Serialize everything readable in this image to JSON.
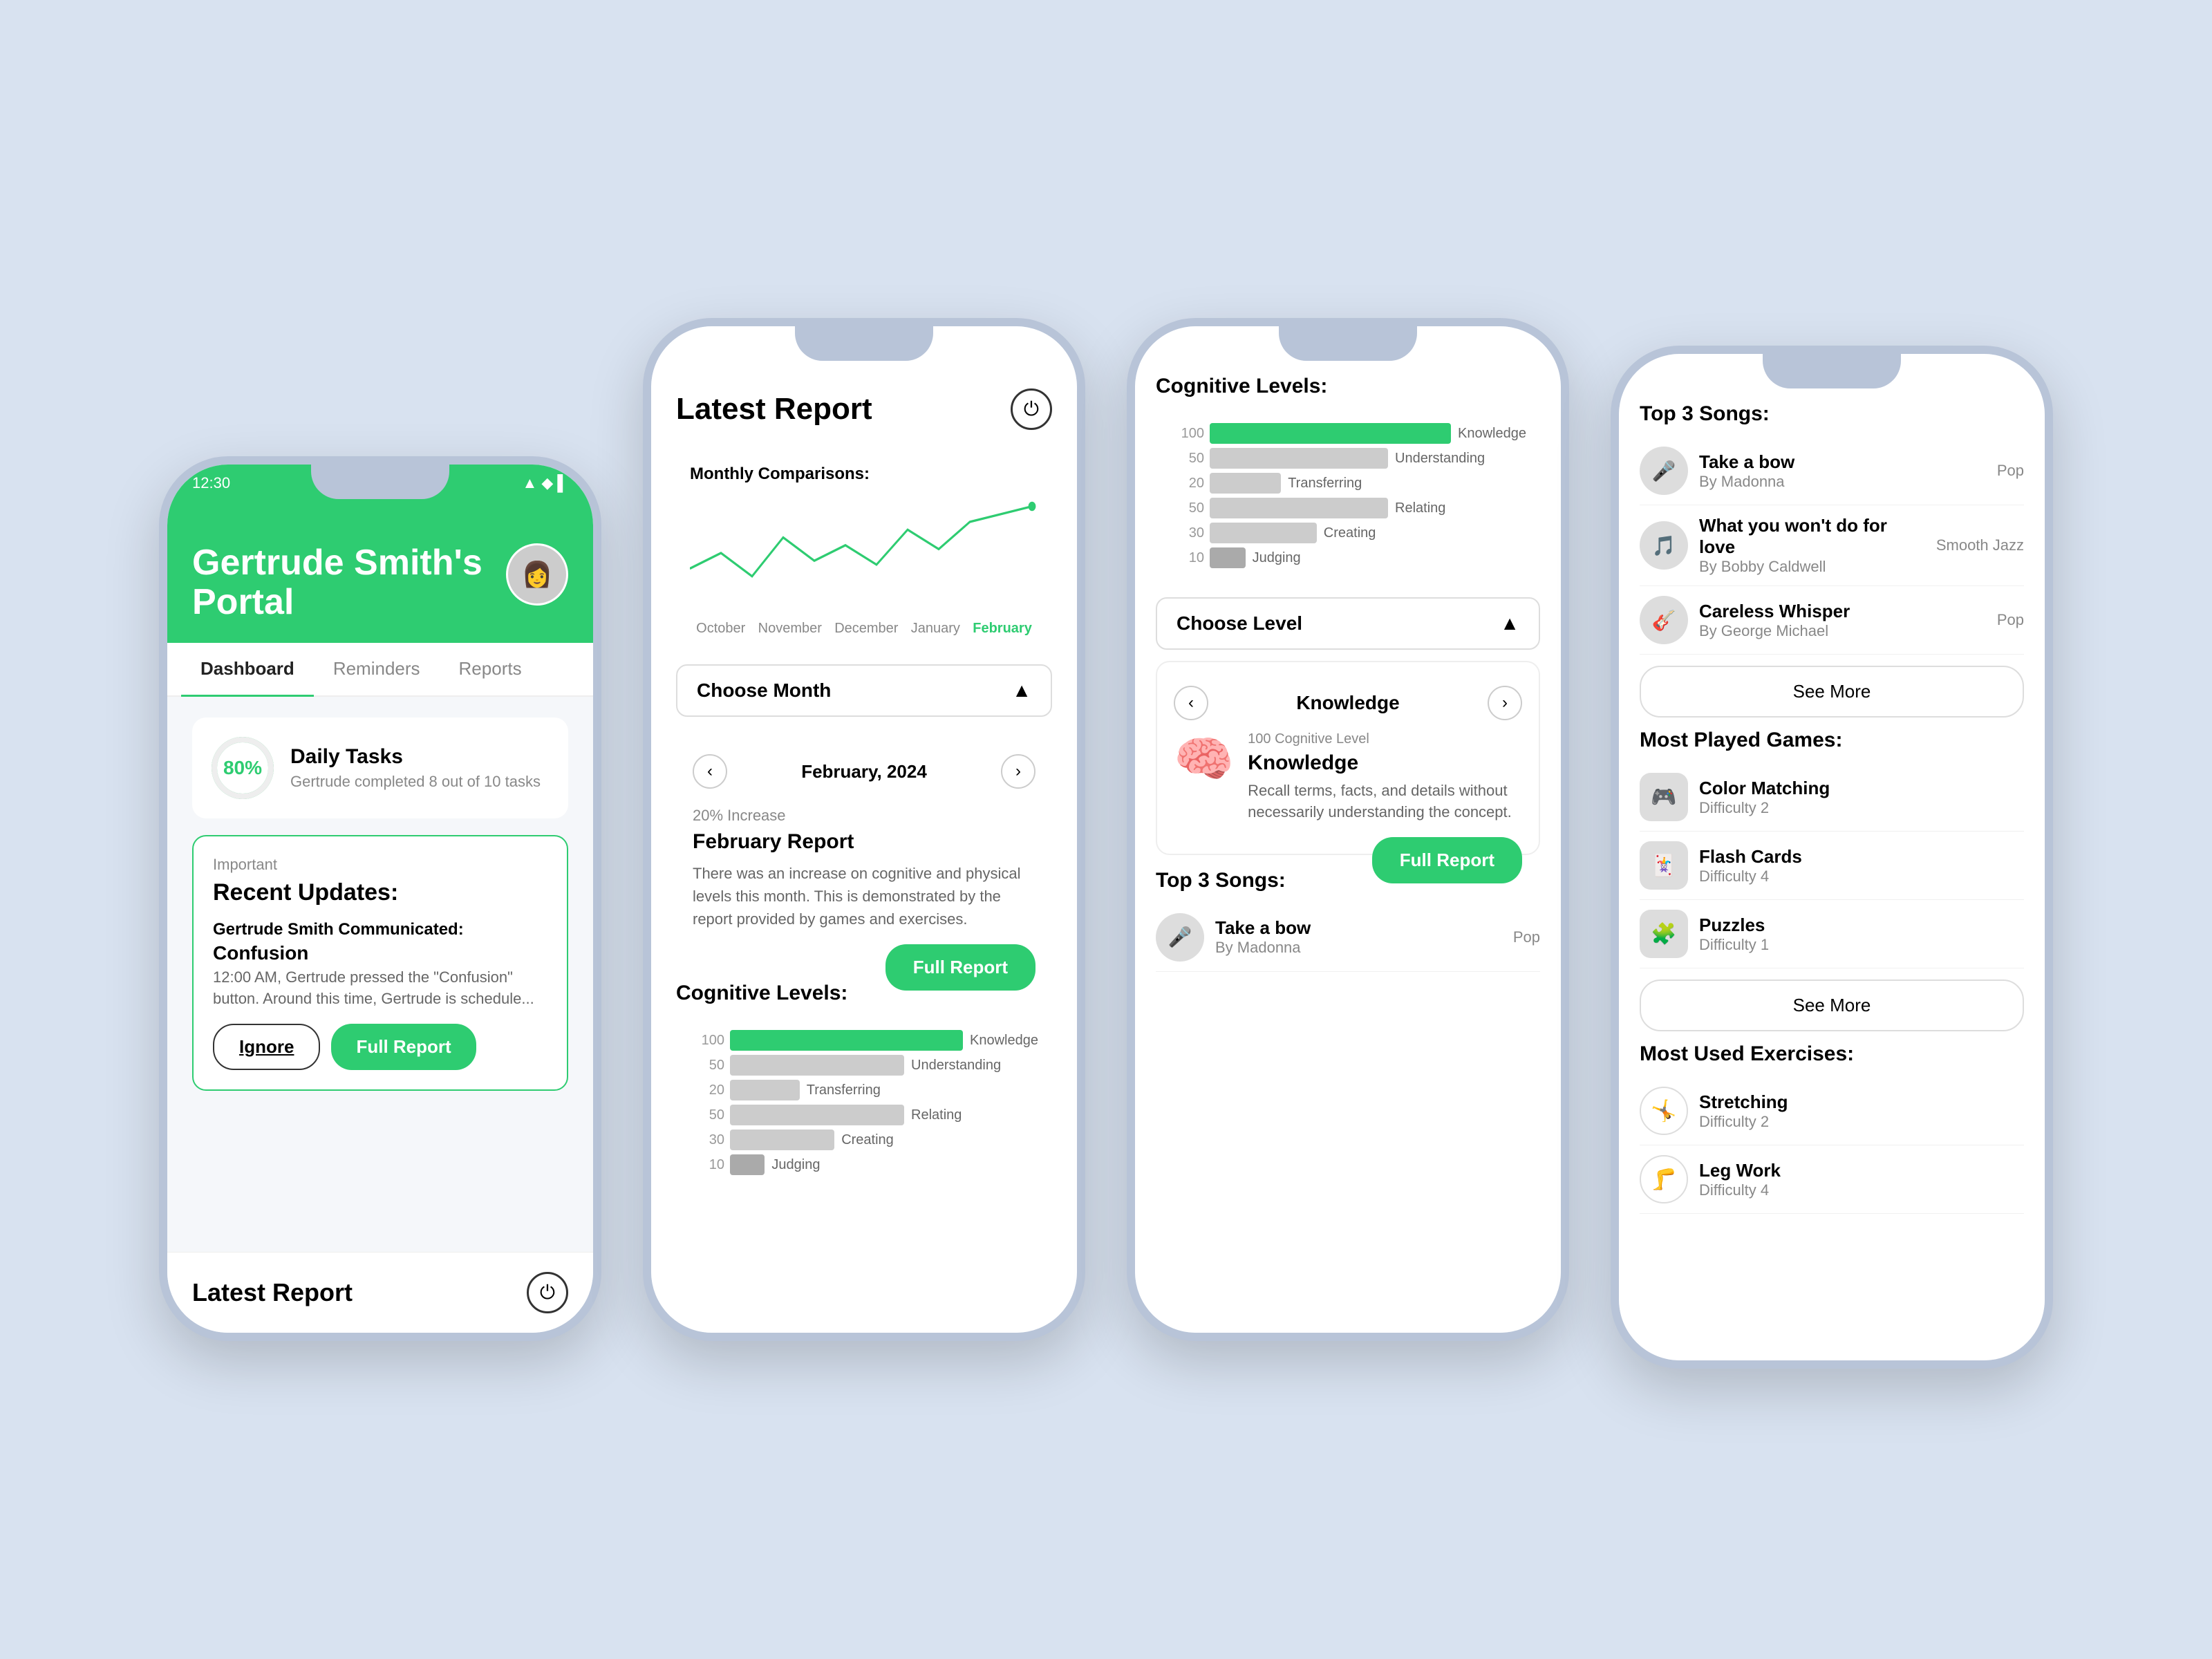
{
  "background": "#d8e2f0",
  "phone1": {
    "status_time": "12:30",
    "header_title": "Gertrude Smith's Portal",
    "tabs": [
      "Dashboard",
      "Reminders",
      "Reports"
    ],
    "active_tab": "Dashboard",
    "daily_tasks": {
      "percent": "80%",
      "title": "Daily Tasks",
      "subtitle": "Gertrude completed 8 out of 10 tasks"
    },
    "updates": {
      "label": "Important",
      "title": "Recent Updates:",
      "who": "Gertrude Smith Communicated:",
      "what": "Confusion",
      "detail": "12:00 AM, Gertrude pressed the \"Confusion\" button. Around this time, Gertrude is schedule...",
      "btn_ignore": "Ignore",
      "btn_report": "Full Report"
    },
    "footer_title": "Latest Report"
  },
  "phone2": {
    "title": "Latest Report",
    "monthly_comparisons_label": "Monthly Comparisons:",
    "chart_months": [
      "October",
      "November",
      "December",
      "January",
      "February"
    ],
    "active_month": "February",
    "choose_month_label": "Choose Month",
    "chevron_up": "▲",
    "nav_prev": "‹",
    "nav_next": "›",
    "selected_month": "February, 2024",
    "increase_label": "20% Increase",
    "report_title": "February Report",
    "report_text": "There was an increase on cognitive and physical levels this month. This is demonstrated by the report provided by games and exercises.",
    "full_report_btn": "Full Report",
    "cognitive_title": "Cognitive Levels:",
    "cog_bars": [
      {
        "value": 100,
        "label": "Knowledge",
        "width_pct": 100
      },
      {
        "value": 50,
        "label": "Understanding",
        "width_pct": 50
      },
      {
        "value": 20,
        "label": "Transferring",
        "width_pct": 20
      },
      {
        "value": 50,
        "label": "Relating",
        "width_pct": 50
      },
      {
        "value": 30,
        "label": "Creating",
        "width_pct": 30
      },
      {
        "value": 10,
        "label": "Judging",
        "width_pct": 10
      }
    ]
  },
  "phone3": {
    "cognitive_title": "Cognitive Levels:",
    "cog_bars": [
      {
        "value": 100,
        "label": "Knowledge",
        "width_pct": 100
      },
      {
        "value": 50,
        "label": "Understanding",
        "width_pct": 50
      },
      {
        "value": 20,
        "label": "Transferring",
        "width_pct": 20
      },
      {
        "value": 50,
        "label": "Relating",
        "width_pct": 50
      },
      {
        "value": 30,
        "label": "Creating",
        "width_pct": 30
      },
      {
        "value": 10,
        "label": "Judging",
        "width_pct": 10
      }
    ],
    "choose_level_label": "Choose Level",
    "nav_prev": "‹",
    "nav_next": "›",
    "level_name": "Knowledge",
    "level_sub": "100 Cognitive Level",
    "level_desc": "Recall terms, facts, and details without necessarily understanding the concept.",
    "full_report_btn": "Full Report",
    "songs_title": "Top 3 Songs:",
    "songs": [
      {
        "name": "Take a bow",
        "artist": "By Madonna",
        "genre": "Pop",
        "emoji": "🎤"
      }
    ]
  },
  "phone4": {
    "songs_title": "Top 3 Songs:",
    "songs": [
      {
        "name": "Take a bow",
        "artist": "By Madonna",
        "genre": "Pop",
        "emoji": "🎤"
      },
      {
        "name": "What you won't do for love",
        "artist": "By Bobby Caldwell",
        "genre": "Smooth Jazz",
        "emoji": "🎵"
      },
      {
        "name": "Careless Whisper",
        "artist": "By George Michael",
        "genre": "Pop",
        "emoji": "🎸"
      }
    ],
    "see_more_songs": "See More",
    "games_title": "Most Played Games:",
    "games": [
      {
        "name": "Color Matching",
        "diff": "Difficulty 2",
        "emoji": "🎮"
      },
      {
        "name": "Flash Cards",
        "diff": "Difficulty 4",
        "emoji": "🃏"
      },
      {
        "name": "Puzzles",
        "diff": "Difficulty 1",
        "emoji": "🧩"
      }
    ],
    "see_more_games": "See More",
    "exercises_title": "Most Used Exercises:",
    "exercises": [
      {
        "name": "Stretching",
        "diff": "Difficulty 2",
        "emoji": "🤸"
      },
      {
        "name": "Leg Work",
        "diff": "Difficulty 4",
        "emoji": "🦵"
      }
    ]
  }
}
